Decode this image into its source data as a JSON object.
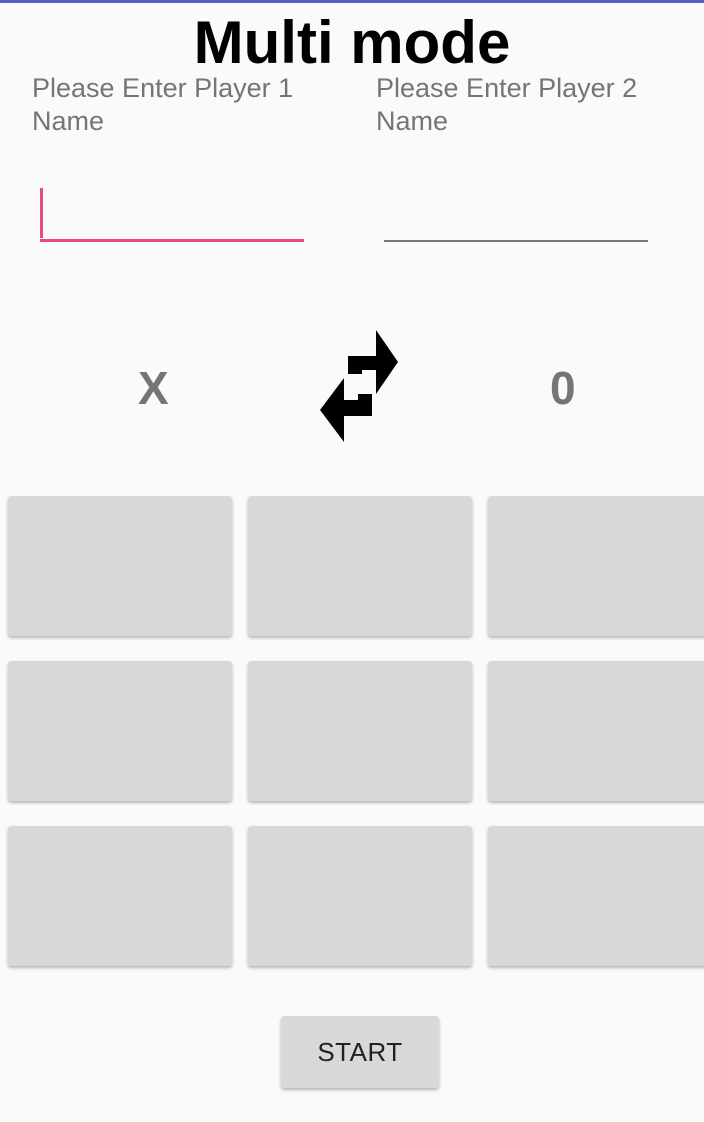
{
  "colors": {
    "accent": "#e64a7f",
    "status_bar": "#5c5ec8",
    "cell_background": "#d7d8d8",
    "text_secondary": "#757575"
  },
  "header": {
    "title": "Multi mode"
  },
  "players": {
    "player1": {
      "label": "Please Enter Player 1 Name",
      "value": ""
    },
    "player2": {
      "label": "Please Enter Player 2 Name",
      "value": ""
    }
  },
  "symbols": {
    "player1": "X",
    "player2": "0",
    "swap_icon": "swap-arrows-icon"
  },
  "board": {
    "cells": [
      "",
      "",
      "",
      "",
      "",
      "",
      "",
      "",
      ""
    ]
  },
  "actions": {
    "start_label": "START"
  }
}
